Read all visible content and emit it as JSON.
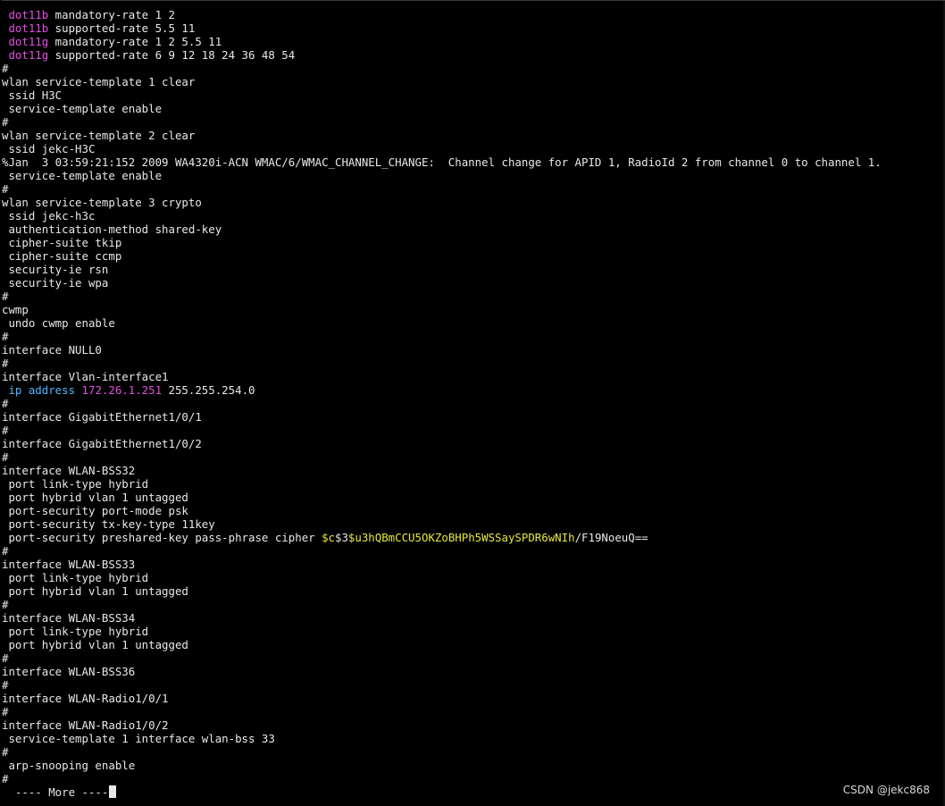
{
  "colors": {
    "background": "#000000",
    "text": "#e8e8e8",
    "keyword_magenta": "#e34ee3",
    "keyword_cyan": "#4fb8ff",
    "string_yellow": "#e8e836"
  },
  "terminal": {
    "lines": [
      [
        {
          "t": " dot11b",
          "c": "magenta"
        },
        {
          "t": " mandatory-rate 1 2",
          "c": "white"
        }
      ],
      [
        {
          "t": " dot11b",
          "c": "magenta"
        },
        {
          "t": " supported-rate 5.5 11",
          "c": "white"
        }
      ],
      [
        {
          "t": " dot11g",
          "c": "magenta"
        },
        {
          "t": " mandatory-rate 1 2 5.5 11",
          "c": "white"
        }
      ],
      [
        {
          "t": " dot11g",
          "c": "magenta"
        },
        {
          "t": " supported-rate 6 9 12 18 24 36 48 54",
          "c": "white"
        }
      ],
      [
        {
          "t": "#",
          "c": "white"
        }
      ],
      [
        {
          "t": "wlan service-template 1 clear",
          "c": "white"
        }
      ],
      [
        {
          "t": " ssid H3C",
          "c": "white"
        }
      ],
      [
        {
          "t": " service-template enable",
          "c": "white"
        }
      ],
      [
        {
          "t": "#",
          "c": "white"
        }
      ],
      [
        {
          "t": "wlan service-template 2 clear",
          "c": "white"
        }
      ],
      [
        {
          "t": " ssid jekc-H3C",
          "c": "white"
        }
      ],
      [
        {
          "t": "%Jan  3 03:59:21:152 2009 WA4320i-ACN WMAC/6/WMAC_CHANNEL_CHANGE:  Channel change for APID 1, RadioId 2 from channel 0 to channel 1.",
          "c": "white"
        }
      ],
      [
        {
          "t": " service-template enable",
          "c": "white"
        }
      ],
      [
        {
          "t": "#",
          "c": "white"
        }
      ],
      [
        {
          "t": "wlan service-template 3 crypto",
          "c": "white"
        }
      ],
      [
        {
          "t": " ssid jekc-h3c",
          "c": "white"
        }
      ],
      [
        {
          "t": " authentication-method shared-key",
          "c": "white"
        }
      ],
      [
        {
          "t": " cipher-suite tkip",
          "c": "white"
        }
      ],
      [
        {
          "t": " cipher-suite ccmp",
          "c": "white"
        }
      ],
      [
        {
          "t": " security-ie rsn",
          "c": "white"
        }
      ],
      [
        {
          "t": " security-ie wpa",
          "c": "white"
        }
      ],
      [
        {
          "t": "#",
          "c": "white"
        }
      ],
      [
        {
          "t": "cwmp",
          "c": "white"
        }
      ],
      [
        {
          "t": " undo cwmp enable",
          "c": "white"
        }
      ],
      [
        {
          "t": "#",
          "c": "white"
        }
      ],
      [
        {
          "t": "interface NULL0",
          "c": "white"
        }
      ],
      [
        {
          "t": "#",
          "c": "white"
        }
      ],
      [
        {
          "t": "interface Vlan-interface1",
          "c": "white"
        }
      ],
      [
        {
          "t": " ip address",
          "c": "cyan"
        },
        {
          "t": " 172.26.1.251",
          "c": "magenta"
        },
        {
          "t": " 255.255.254.0",
          "c": "white"
        }
      ],
      [
        {
          "t": "#",
          "c": "white"
        }
      ],
      [
        {
          "t": "interface GigabitEthernet1/0/1",
          "c": "white"
        }
      ],
      [
        {
          "t": "#",
          "c": "white"
        }
      ],
      [
        {
          "t": "interface GigabitEthernet1/0/2",
          "c": "white"
        }
      ],
      [
        {
          "t": "#",
          "c": "white"
        }
      ],
      [
        {
          "t": "interface WLAN-BSS32",
          "c": "white"
        }
      ],
      [
        {
          "t": " port link-type hybrid",
          "c": "white"
        }
      ],
      [
        {
          "t": " port hybrid vlan 1 untagged",
          "c": "white"
        }
      ],
      [
        {
          "t": " port-security port-mode psk",
          "c": "white"
        }
      ],
      [
        {
          "t": " port-security tx-key-type 11key",
          "c": "white"
        }
      ],
      [
        {
          "t": " port-security preshared-key pass-phrase cipher ",
          "c": "white"
        },
        {
          "t": "$c",
          "c": "yellow"
        },
        {
          "t": "$3",
          "c": "white"
        },
        {
          "t": "$u3hQBmCCU5OKZoBHPh5WSSaySPDR6wNIh",
          "c": "yellow"
        },
        {
          "t": "/F19NoeuQ==",
          "c": "white"
        }
      ],
      [
        {
          "t": "#",
          "c": "white"
        }
      ],
      [
        {
          "t": "interface WLAN-BSS33",
          "c": "white"
        }
      ],
      [
        {
          "t": " port link-type hybrid",
          "c": "white"
        }
      ],
      [
        {
          "t": " port hybrid vlan 1 untagged",
          "c": "white"
        }
      ],
      [
        {
          "t": "#",
          "c": "white"
        }
      ],
      [
        {
          "t": "interface WLAN-BSS34",
          "c": "white"
        }
      ],
      [
        {
          "t": " port link-type hybrid",
          "c": "white"
        }
      ],
      [
        {
          "t": " port hybrid vlan 1 untagged",
          "c": "white"
        }
      ],
      [
        {
          "t": "#",
          "c": "white"
        }
      ],
      [
        {
          "t": "interface WLAN-BSS36",
          "c": "white"
        }
      ],
      [
        {
          "t": "#",
          "c": "white"
        }
      ],
      [
        {
          "t": "interface WLAN-Radio1/0/1",
          "c": "white"
        }
      ],
      [
        {
          "t": "#",
          "c": "white"
        }
      ],
      [
        {
          "t": "interface WLAN-Radio1/0/2",
          "c": "white"
        }
      ],
      [
        {
          "t": " service-template 1 interface wlan-bss 33",
          "c": "white"
        }
      ],
      [
        {
          "t": "#",
          "c": "white"
        }
      ],
      [
        {
          "t": " arp-snooping enable",
          "c": "white"
        }
      ],
      [
        {
          "t": "#",
          "c": "white"
        }
      ]
    ],
    "more_prompt": "  ---- More ----"
  },
  "watermark": "CSDN @jekc868"
}
